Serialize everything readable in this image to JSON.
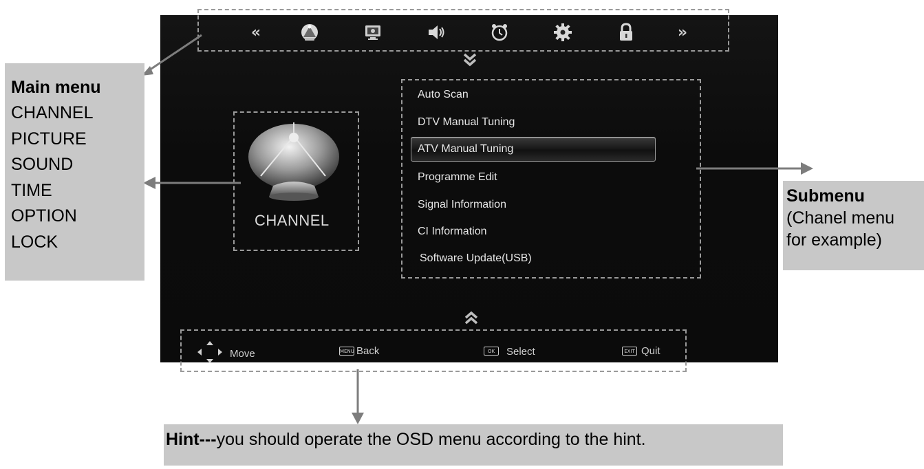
{
  "top_bar": {
    "prev": "«",
    "next": "»",
    "icons": [
      "channel-icon",
      "picture-icon",
      "sound-icon",
      "time-icon",
      "option-icon",
      "lock-icon"
    ],
    "down_chevron": "︾"
  },
  "main_panel": {
    "label": "CHANNEL",
    "icon": "satellite-dish-icon"
  },
  "submenu": {
    "items": [
      "Auto Scan",
      "DTV Manual Tuning",
      "ATV Manual Tuning",
      "Programme Edit",
      "Signal Information",
      "CI Information",
      "Software Update(USB)"
    ],
    "selected_index": 2
  },
  "up_chevron": "︽",
  "hints": {
    "move": "Move",
    "back": "Back",
    "back_key": "MENU",
    "select": "Select",
    "select_key": "OK",
    "quit": "Quit",
    "quit_key": "EXIT"
  },
  "callouts": {
    "main_menu": {
      "title": "Main menu",
      "items": [
        "CHANNEL",
        "PICTURE",
        "SOUND",
        "TIME",
        "OPTION",
        "LOCK"
      ]
    },
    "submenu": {
      "title": "Submenu",
      "desc1": "(Chanel menu",
      "desc2": "for example)"
    },
    "hint": {
      "bold": "Hint---",
      "text": "you should operate the OSD menu according to the hint."
    }
  },
  "colors": {
    "screen_bg": "#111111",
    "callout_bg": "#c8c8c8",
    "arrow": "#7d7d7d",
    "dash": "#9a9a9a"
  }
}
